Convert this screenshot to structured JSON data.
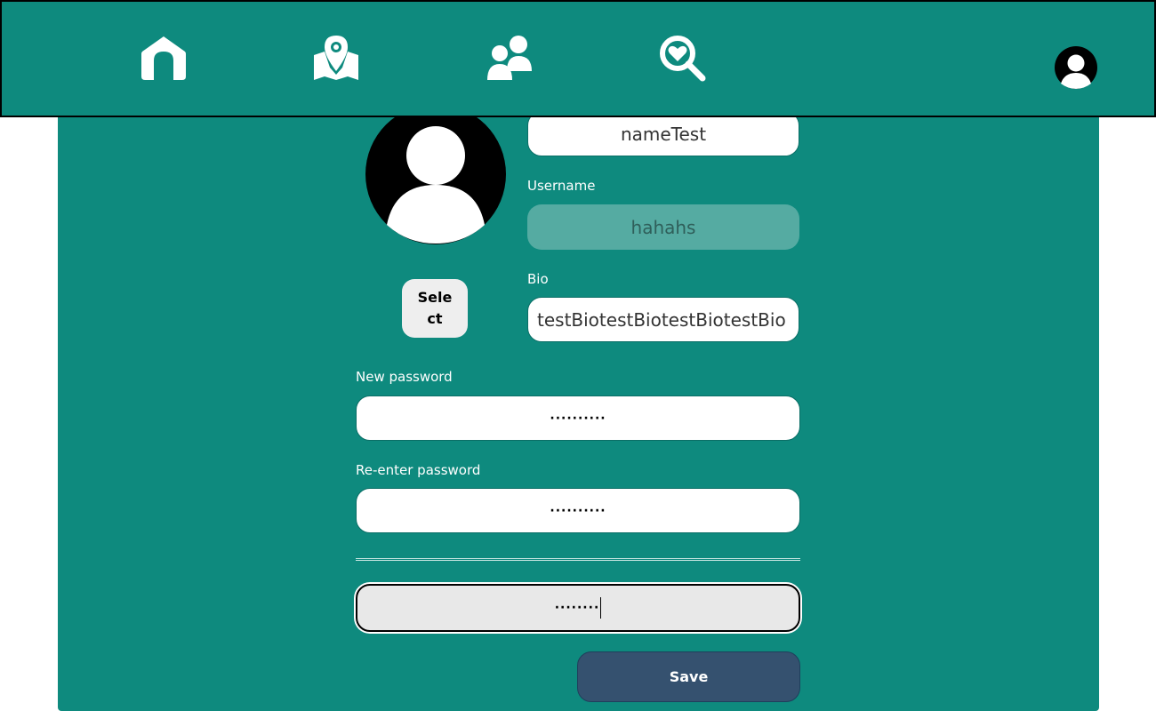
{
  "nav": {
    "icons": [
      "home-icon",
      "map-pin-icon",
      "friends-icon",
      "search-heart-icon",
      "user-avatar-icon"
    ]
  },
  "profile": {
    "select_label": "Select",
    "name_value": "nameTest",
    "username_label": "Username",
    "username_value": "hahahs",
    "bio_label": "Bio",
    "bio_value": "testBiotestBiotestBiotestBio",
    "new_password_label": "New password",
    "new_password_value": "··········",
    "reenter_password_label": "Re-enter password",
    "reenter_password_value": "··········",
    "current_password_value": "········",
    "save_label": "Save"
  },
  "colors": {
    "accent": "#0e8a7e",
    "save_button": "#35516f",
    "disabled_field": "#55aba2"
  }
}
